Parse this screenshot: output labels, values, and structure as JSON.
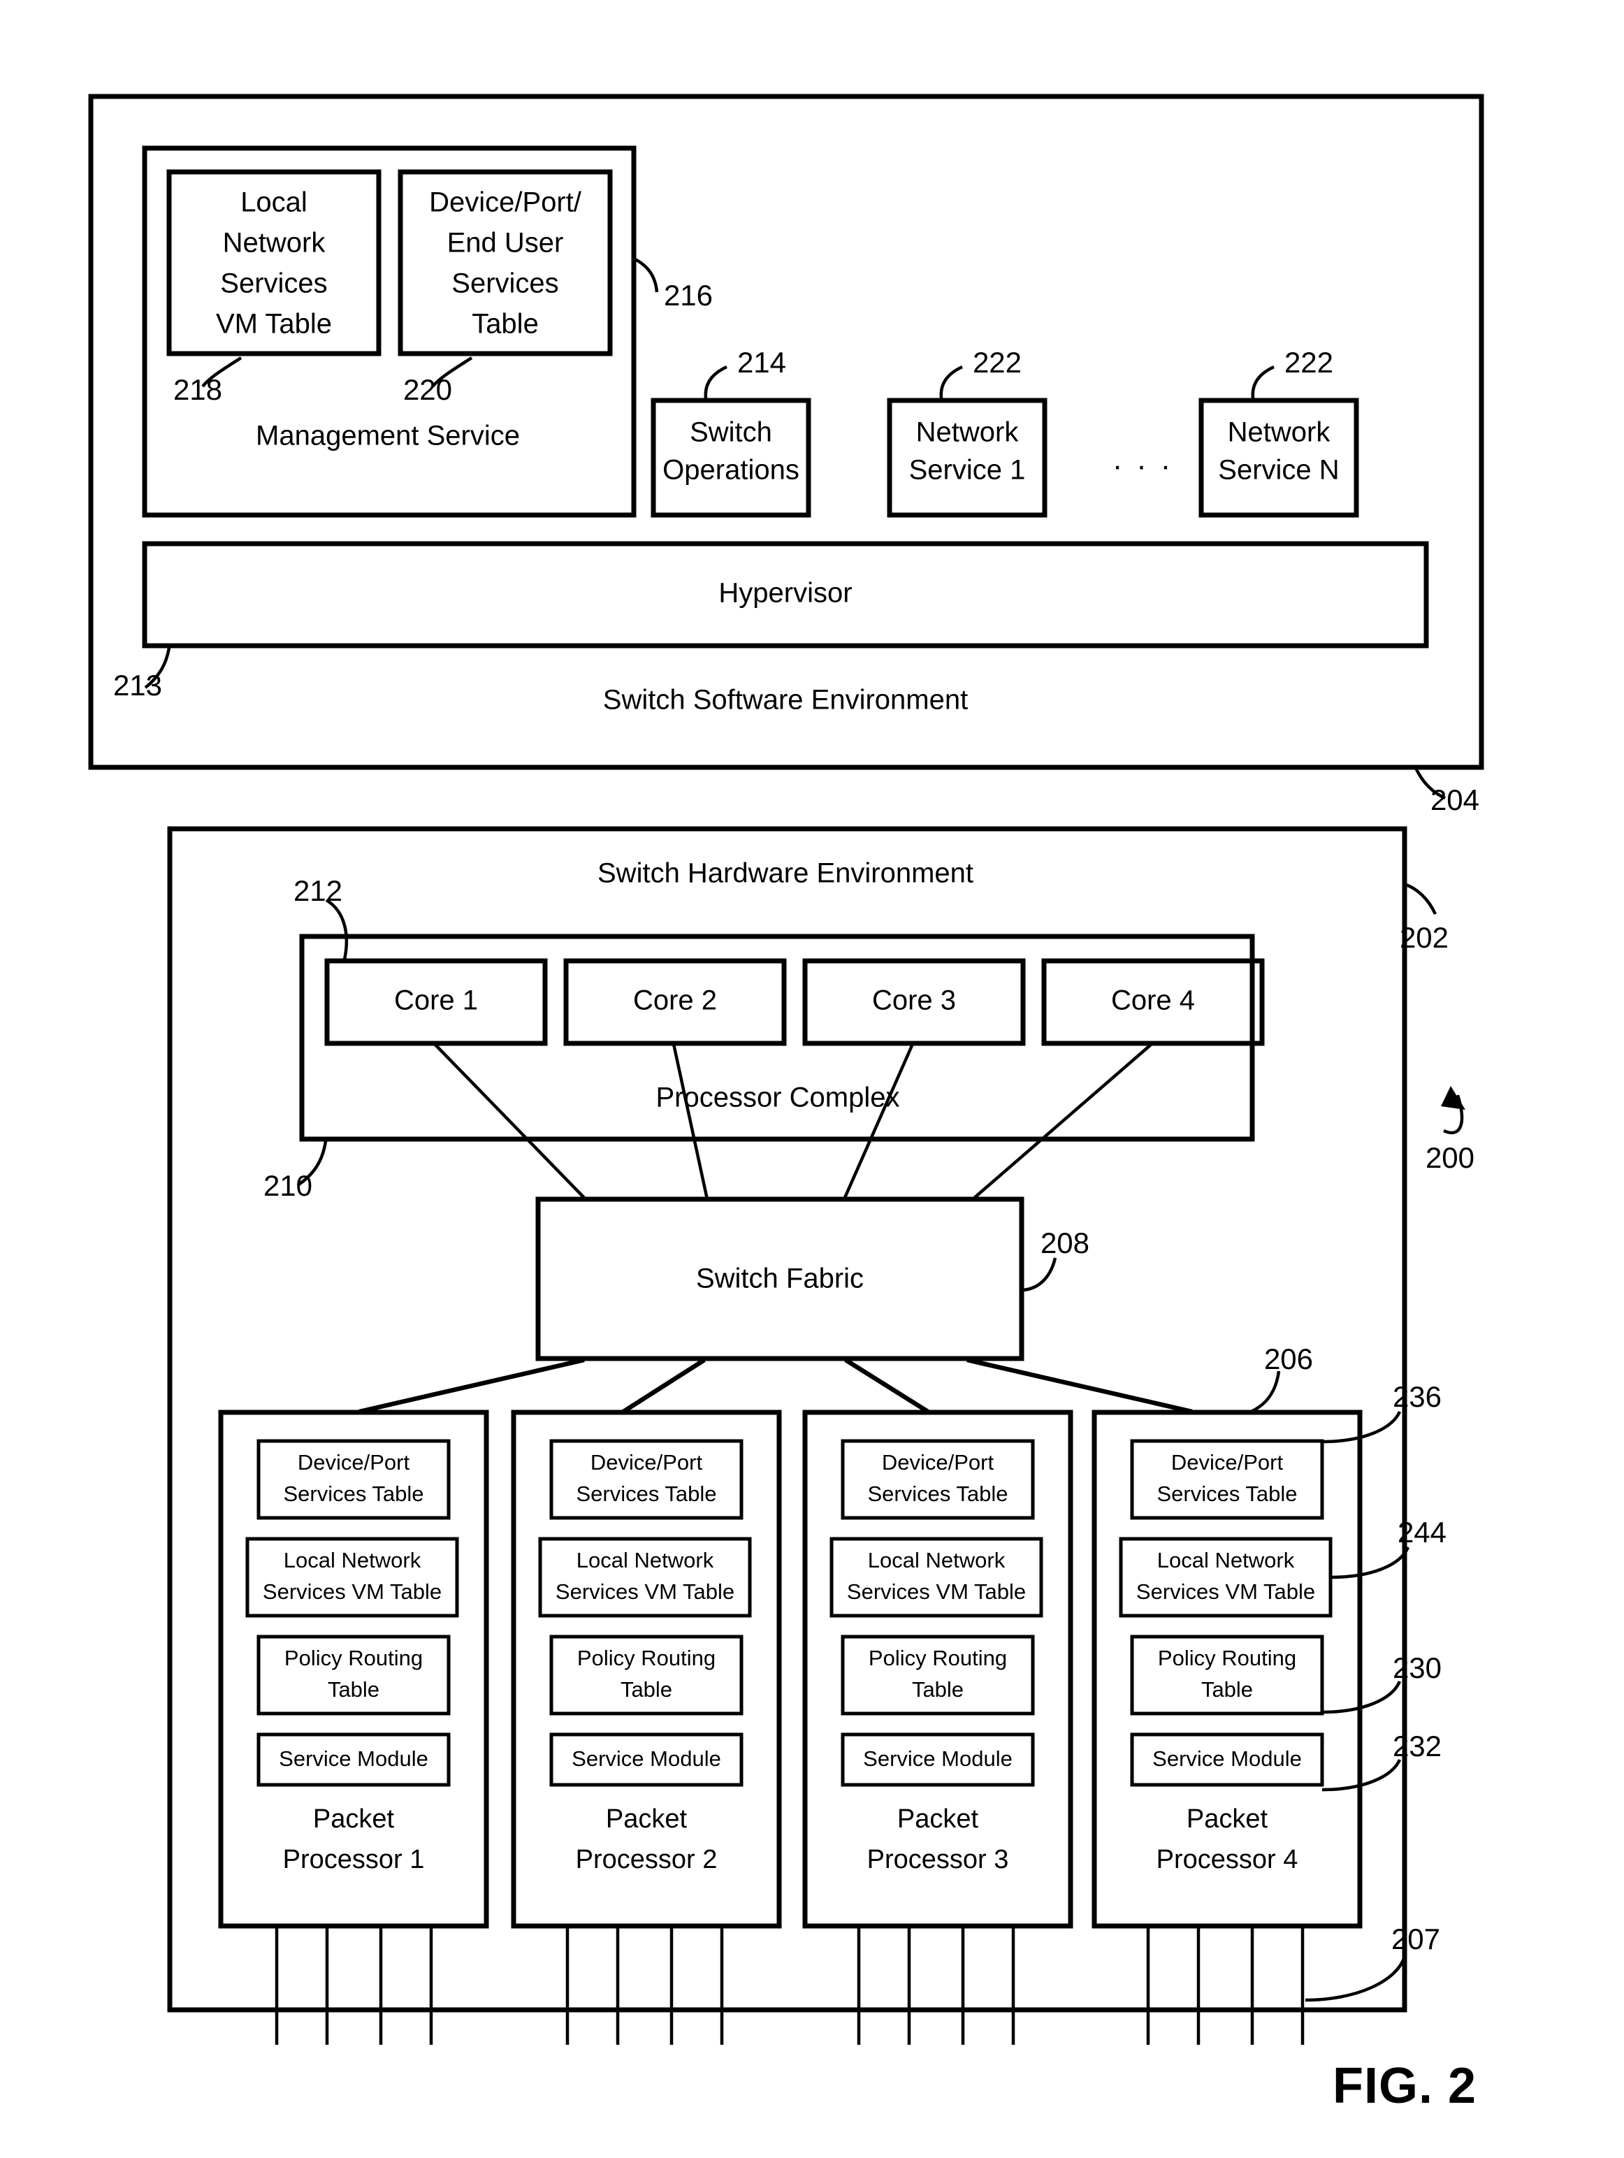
{
  "figure": {
    "caption": "FIG. 2"
  },
  "software_environment": {
    "ref": "204",
    "title": "Switch Software Environment",
    "management_service": {
      "ref": "216",
      "title": "Management Service",
      "tables": [
        {
          "ref": "218",
          "label": "Local\nNetwork\nServices\nVM Table",
          "lines": [
            "Local",
            "Network",
            "Services",
            "VM Table"
          ]
        },
        {
          "ref": "220",
          "label": "Device/Port/\nEnd User\nServices\nTable",
          "lines": [
            "Device/Port/",
            "End User",
            "Services",
            "Table"
          ]
        }
      ]
    },
    "services": [
      {
        "ref": "214",
        "lines": [
          "Switch",
          "Operations"
        ]
      },
      {
        "ref": "222",
        "lines": [
          "Network",
          "Service 1"
        ]
      },
      {
        "ref": "222",
        "lines": [
          "Network",
          "Service N"
        ]
      }
    ],
    "ellipsis": ". . .",
    "hypervisor": {
      "ref": "213",
      "label": "Hypervisor"
    }
  },
  "hardware_environment": {
    "ref": "202",
    "title": "Switch Hardware Environment",
    "overall_ref": "200",
    "processor_complex": {
      "ref": "210",
      "label": "Processor Complex",
      "core_ref": "212",
      "cores": [
        "Core 1",
        "Core 2",
        "Core 3",
        "Core 4"
      ]
    },
    "switch_fabric": {
      "ref": "208",
      "label": "Switch Fabric"
    },
    "packet_processor_ref": "206",
    "ports_ref": "207",
    "module_refs": [
      {
        "ref": "236",
        "target": "Device/Port Services Table"
      },
      {
        "ref": "244",
        "target": "Local Network Services VM Table"
      },
      {
        "ref": "230",
        "target": "Policy Routing Table"
      },
      {
        "ref": "232",
        "target": "Service Module"
      }
    ],
    "packet_processors": [
      {
        "title_lines": [
          "Packet",
          "Processor 1"
        ],
        "modules": [
          {
            "lines": [
              "Device/Port",
              "Services Table"
            ]
          },
          {
            "lines": [
              "Local Network",
              "Services VM Table"
            ]
          },
          {
            "lines": [
              "Policy Routing",
              "Table"
            ]
          },
          {
            "lines": [
              "Service Module"
            ]
          }
        ]
      },
      {
        "title_lines": [
          "Packet",
          "Processor 2"
        ],
        "modules": [
          {
            "lines": [
              "Device/Port",
              "Services Table"
            ]
          },
          {
            "lines": [
              "Local Network",
              "Services VM Table"
            ]
          },
          {
            "lines": [
              "Policy Routing",
              "Table"
            ]
          },
          {
            "lines": [
              "Service Module"
            ]
          }
        ]
      },
      {
        "title_lines": [
          "Packet",
          "Processor 3"
        ],
        "modules": [
          {
            "lines": [
              "Device/Port",
              "Services Table"
            ]
          },
          {
            "lines": [
              "Local Network",
              "Services VM Table"
            ]
          },
          {
            "lines": [
              "Policy Routing",
              "Table"
            ]
          },
          {
            "lines": [
              "Service Module"
            ]
          }
        ]
      },
      {
        "title_lines": [
          "Packet",
          "Processor 4"
        ],
        "modules": [
          {
            "lines": [
              "Device/Port",
              "Services Table"
            ]
          },
          {
            "lines": [
              "Local Network",
              "Services VM Table"
            ]
          },
          {
            "lines": [
              "Policy Routing",
              "Table"
            ]
          },
          {
            "lines": [
              "Service Module"
            ]
          }
        ]
      }
    ]
  }
}
